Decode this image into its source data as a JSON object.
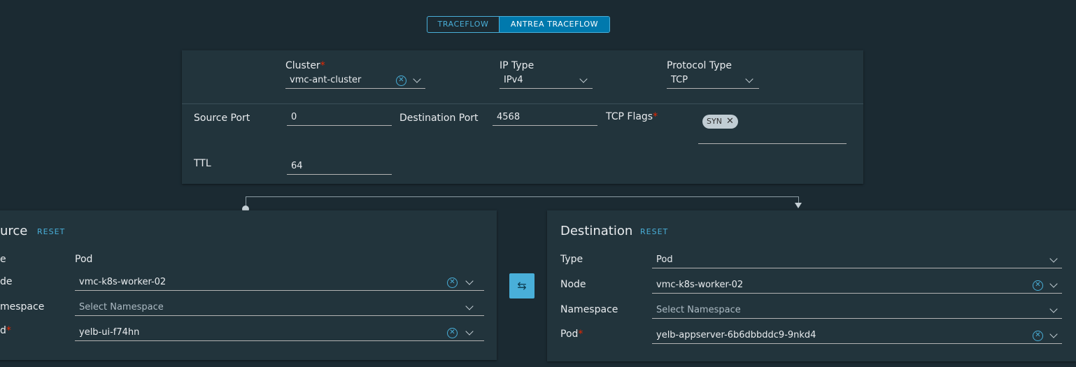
{
  "toggle": {
    "traceflow": "TRACEFLOW",
    "antrea": "ANTREA TRACEFLOW"
  },
  "settings": {
    "cluster_label": "Cluster",
    "cluster_value": "vmc-ant-cluster",
    "ip_type_label": "IP Type",
    "ip_type_value": "IPv4",
    "protocol_label": "Protocol Type",
    "protocol_value": "TCP",
    "source_port_label": "Source Port",
    "source_port_value": "0",
    "dest_port_label": "Destination Port",
    "dest_port_value": "4568",
    "tcp_flags_label": "TCP Flags",
    "tcp_flag_chip": "SYN",
    "ttl_label": "TTL",
    "ttl_value": "64",
    "required_mark": "*"
  },
  "source": {
    "title": "Source",
    "title_visible": "urce",
    "reset": "RESET",
    "type_label_visible": "e",
    "type_value": "Pod",
    "node_label_visible": "de",
    "node_value": "vmc-k8s-worker-02",
    "namespace_label_visible": "mespace",
    "namespace_placeholder": "Select Namespace",
    "pod_label_visible": "d",
    "pod_value": "yelb-ui-f74hn"
  },
  "swap": {
    "icon": "⇆"
  },
  "destination": {
    "title": "Destination",
    "reset": "RESET",
    "type_label": "Type",
    "type_value": "Pod",
    "node_label": "Node",
    "node_value": "vmc-k8s-worker-02",
    "namespace_label": "Namespace",
    "namespace_placeholder": "Select Namespace",
    "pod_label": "Pod",
    "pod_value": "yelb-appserver-6b6dbbddc9-9nkd4"
  },
  "colors": {
    "accent": "#49afd9",
    "active": "#0079ad",
    "required": "#e62700",
    "panel": "#22343c",
    "background": "#1b2a32"
  }
}
